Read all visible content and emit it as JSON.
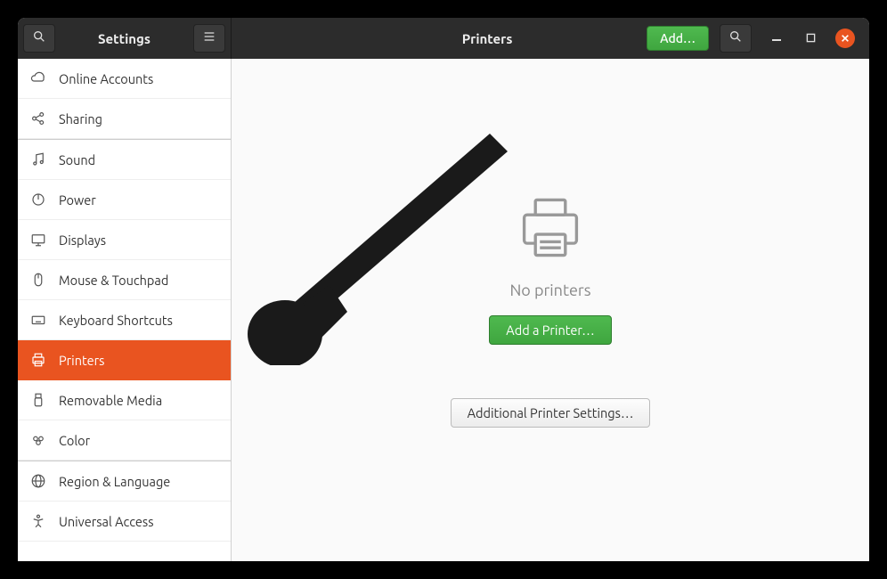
{
  "colors": {
    "accent": "#e95420",
    "primary_action": "#3fa63f",
    "titlebar": "#2c2c2c"
  },
  "titlebar": {
    "left_title": "Settings",
    "right_title": "Printers",
    "add_label": "Add…"
  },
  "sidebar": {
    "items": [
      {
        "id": "online-accounts",
        "label": "Online Accounts",
        "icon": "cloud"
      },
      {
        "id": "sharing",
        "label": "Sharing",
        "icon": "share"
      },
      {
        "id": "sound",
        "label": "Sound",
        "icon": "music"
      },
      {
        "id": "power",
        "label": "Power",
        "icon": "power"
      },
      {
        "id": "displays",
        "label": "Displays",
        "icon": "monitor"
      },
      {
        "id": "mouse",
        "label": "Mouse & Touchpad",
        "icon": "mouse"
      },
      {
        "id": "keyboard",
        "label": "Keyboard Shortcuts",
        "icon": "keyboard"
      },
      {
        "id": "printers",
        "label": "Printers",
        "icon": "printer",
        "active": true
      },
      {
        "id": "removable",
        "label": "Removable Media",
        "icon": "usb"
      },
      {
        "id": "color",
        "label": "Color",
        "icon": "palette"
      },
      {
        "id": "region",
        "label": "Region & Language",
        "icon": "globe"
      },
      {
        "id": "universal",
        "label": "Universal Access",
        "icon": "accessibility"
      }
    ],
    "separator_after": [
      "sharing",
      "color"
    ]
  },
  "main": {
    "empty_heading": "No printers",
    "add_button": "Add a Printer…",
    "additional_button": "Additional Printer Settings…"
  }
}
